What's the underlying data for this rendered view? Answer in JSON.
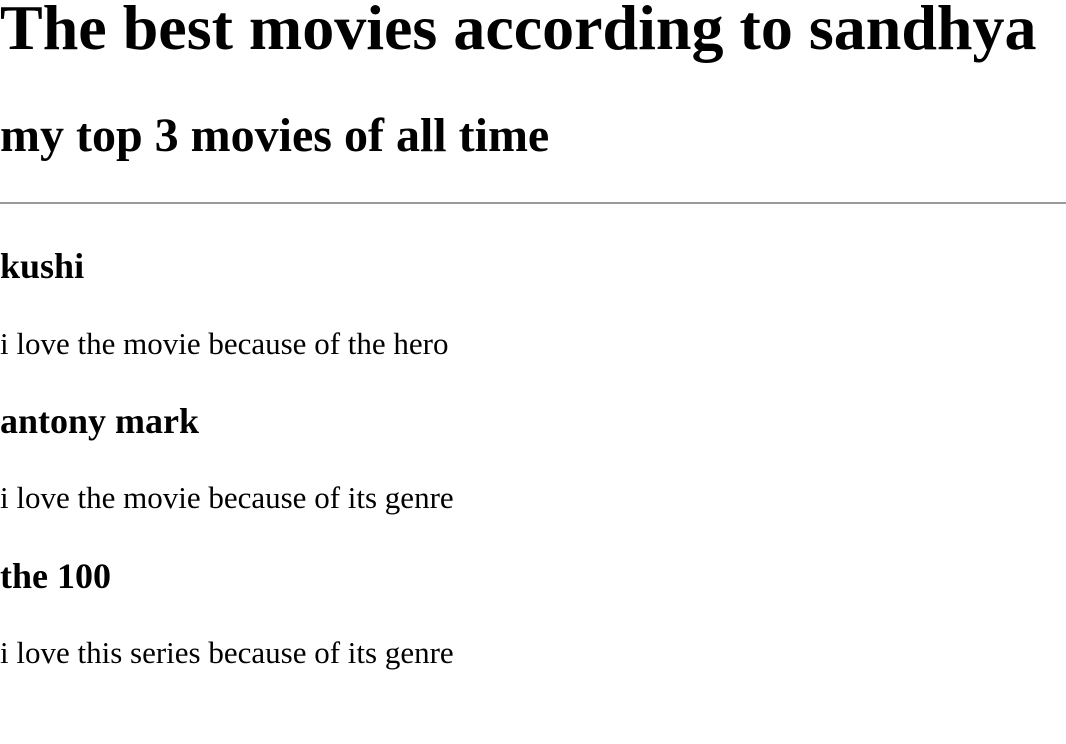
{
  "page": {
    "title": "The best movies according to sandhya",
    "subtitle": "my top 3 movies of all time"
  },
  "movies": [
    {
      "title": "kushi",
      "description": "i love the movie because of the hero"
    },
    {
      "title": "antony mark",
      "description": "i love the movie because of its genre"
    },
    {
      "title": "the 100",
      "description": "i love this series because of its genre"
    }
  ]
}
